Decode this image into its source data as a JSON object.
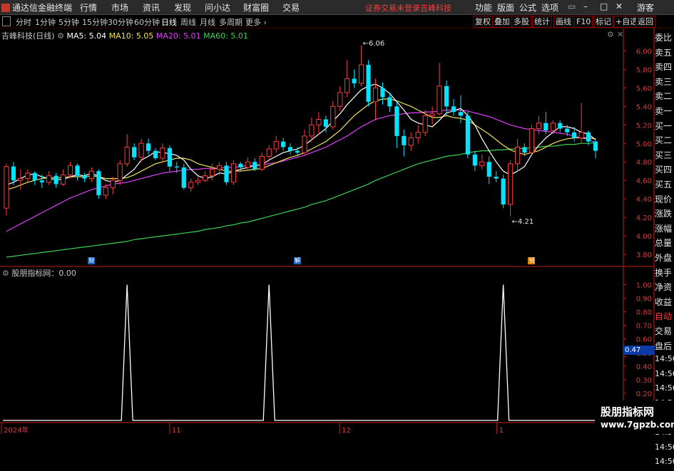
{
  "app": {
    "title": "通达信金融终端"
  },
  "menu": [
    "行情",
    "市场",
    "资讯",
    "发现",
    "问小达",
    "财富圈",
    "交易"
  ],
  "notice": "证券交易未登录",
  "stock_name_header": "吉峰科技",
  "window_menu": [
    "功能",
    "版面",
    "公式",
    "选项"
  ],
  "guest_label": "游客",
  "periods": [
    "分时",
    "1分钟",
    "5分钟",
    "15分钟",
    "30分钟",
    "60分钟",
    "日线",
    "周线",
    "月线",
    "多周期",
    "更多"
  ],
  "active_period": "日线",
  "right_buttons": [
    "复权",
    "叠加",
    "多股",
    "统计",
    "画线",
    "F10",
    "标记",
    "+自选",
    "返回"
  ],
  "chart_header": {
    "name": "吉峰科技(日线)",
    "ma5": "MA5: 5.04",
    "ma10": "MA10: 5.05",
    "ma20": "MA20: 5.01",
    "ma60": "MA60: 5.01"
  },
  "side_panel": [
    "委比",
    "卖五",
    "卖四",
    "卖三",
    "卖二",
    "卖一",
    "买一",
    "买二",
    "买三",
    "买四",
    "买五",
    "现价",
    "涨跌",
    "涨幅",
    "总量",
    "外盘",
    "换手",
    "净资",
    "收益",
    "自动",
    "交易",
    "盘后",
    "14:56",
    "14:56",
    "14:56",
    "14:56",
    "14:56",
    "14:56",
    "14:56",
    "14:56"
  ],
  "event_markers": [
    "财",
    "解",
    "预"
  ],
  "indicator_header": "股朋指标网：0.00",
  "indicator_value_box": "0.47",
  "watermark": {
    "name": "股朋指标网",
    "url": "www.7gpzb.com"
  },
  "x_axis_labels": [
    "2024年",
    "11",
    "12",
    "1"
  ],
  "colors": {
    "up": "#ff3b3b",
    "down": "#00e5ff",
    "ma5": "#ffffff",
    "ma10": "#f5e05a",
    "ma20": "#e040fb",
    "ma60": "#39d353",
    "axis": "#c81e1e"
  },
  "chart_data": [
    {
      "type": "candlestick",
      "title": "吉峰科技(日线)",
      "ylim": [
        3.7,
        6.15
      ],
      "y_ticks": [
        3.8,
        4.0,
        4.2,
        4.4,
        4.6,
        4.8,
        5.0,
        5.2,
        5.4,
        5.6,
        5.8,
        6.0
      ],
      "annotations": [
        {
          "label": "6.06",
          "value": 6.06
        },
        {
          "label": "4.21",
          "value": 4.21
        }
      ],
      "candles": [
        [
          4.3,
          4.75,
          4.78,
          4.22
        ],
        [
          4.75,
          4.6,
          4.8,
          4.55
        ],
        [
          4.6,
          4.62,
          4.72,
          4.5
        ],
        [
          4.62,
          4.68,
          4.72,
          4.58
        ],
        [
          4.68,
          4.6,
          4.7,
          4.55
        ],
        [
          4.6,
          4.58,
          4.66,
          4.52
        ],
        [
          4.58,
          4.65,
          4.7,
          4.55
        ],
        [
          4.65,
          4.56,
          4.68,
          4.52
        ],
        [
          4.56,
          4.66,
          4.72,
          4.54
        ],
        [
          4.66,
          4.76,
          4.8,
          4.62
        ],
        [
          4.76,
          4.65,
          4.78,
          4.6
        ],
        [
          4.65,
          4.62,
          4.68,
          4.58
        ],
        [
          4.62,
          4.7,
          4.74,
          4.58
        ],
        [
          4.7,
          4.44,
          4.72,
          4.4
        ],
        [
          4.44,
          4.52,
          4.56,
          4.4
        ],
        [
          4.52,
          4.6,
          4.64,
          4.45
        ],
        [
          4.6,
          4.78,
          4.82,
          4.55
        ],
        [
          4.78,
          4.96,
          5.1,
          4.75
        ],
        [
          4.96,
          4.85,
          5.0,
          4.82
        ],
        [
          4.85,
          5.0,
          5.05,
          4.8
        ],
        [
          5.0,
          4.92,
          5.05,
          4.88
        ],
        [
          4.92,
          4.84,
          4.95,
          4.82
        ],
        [
          4.84,
          4.95,
          5.0,
          4.8
        ],
        [
          4.95,
          4.75,
          4.98,
          4.7
        ],
        [
          4.75,
          4.74,
          4.8,
          4.68
        ],
        [
          4.74,
          4.52,
          4.78,
          4.5
        ],
        [
          4.52,
          4.58,
          4.62,
          4.48
        ],
        [
          4.58,
          4.6,
          4.65,
          4.55
        ],
        [
          4.6,
          4.65,
          4.7,
          4.58
        ],
        [
          4.65,
          4.72,
          4.78,
          4.6
        ],
        [
          4.72,
          4.76,
          4.8,
          4.66
        ],
        [
          4.76,
          4.58,
          4.8,
          4.55
        ],
        [
          4.58,
          4.78,
          4.82,
          4.55
        ],
        [
          4.78,
          4.74,
          4.8,
          4.7
        ],
        [
          4.74,
          4.8,
          4.85,
          4.72
        ],
        [
          4.8,
          4.72,
          4.84,
          4.7
        ],
        [
          4.72,
          4.86,
          4.9,
          4.7
        ],
        [
          4.86,
          4.94,
          4.98,
          4.8
        ],
        [
          4.94,
          5.02,
          5.08,
          4.9
        ],
        [
          5.02,
          4.96,
          5.06,
          4.92
        ],
        [
          4.96,
          4.92,
          5.0,
          4.88
        ],
        [
          4.92,
          4.9,
          4.96,
          4.86
        ],
        [
          4.9,
          5.08,
          5.15,
          4.88
        ],
        [
          5.08,
          5.2,
          5.28,
          5.02
        ],
        [
          5.2,
          5.26,
          5.34,
          5.1
        ],
        [
          5.26,
          5.18,
          5.3,
          5.12
        ],
        [
          5.18,
          5.4,
          5.46,
          5.15
        ],
        [
          5.4,
          5.55,
          5.62,
          5.35
        ],
        [
          5.55,
          5.7,
          5.9,
          5.5
        ],
        [
          5.7,
          5.65,
          5.8,
          5.6
        ],
        [
          5.65,
          5.85,
          6.06,
          5.62
        ],
        [
          5.85,
          5.45,
          5.9,
          5.4
        ],
        [
          5.45,
          5.6,
          5.7,
          5.25
        ],
        [
          5.6,
          5.5,
          5.66,
          5.42
        ],
        [
          5.5,
          5.4,
          5.55,
          5.34
        ],
        [
          5.4,
          5.08,
          5.45,
          4.95
        ],
        [
          5.08,
          4.98,
          5.15,
          4.86
        ],
        [
          4.98,
          5.06,
          5.12,
          4.92
        ],
        [
          5.06,
          5.12,
          5.2,
          5.0
        ],
        [
          5.12,
          5.3,
          5.36,
          5.08
        ],
        [
          5.3,
          5.32,
          5.4,
          5.2
        ],
        [
          5.32,
          5.62,
          5.87,
          5.3
        ],
        [
          5.62,
          5.4,
          5.68,
          5.3
        ],
        [
          5.4,
          5.34,
          5.48,
          5.3
        ],
        [
          5.34,
          5.3,
          5.52,
          5.22
        ],
        [
          5.3,
          4.88,
          5.34,
          4.84
        ],
        [
          4.88,
          4.76,
          4.92,
          4.7
        ],
        [
          4.76,
          4.8,
          4.88,
          4.72
        ],
        [
          4.8,
          4.64,
          4.86,
          4.56
        ],
        [
          4.64,
          4.62,
          4.7,
          4.58
        ],
        [
          4.62,
          4.34,
          4.66,
          4.3
        ],
        [
          4.34,
          4.78,
          4.82,
          4.21
        ],
        [
          4.78,
          4.96,
          5.05,
          4.7
        ],
        [
          4.96,
          4.9,
          5.0,
          4.86
        ],
        [
          4.9,
          5.16,
          5.2,
          4.88
        ],
        [
          5.16,
          5.22,
          5.3,
          5.1
        ],
        [
          5.22,
          5.14,
          5.34,
          5.1
        ],
        [
          5.14,
          5.22,
          5.25,
          5.1
        ],
        [
          5.22,
          5.16,
          5.25,
          5.12
        ],
        [
          5.16,
          5.12,
          5.2,
          5.08
        ],
        [
          5.12,
          5.06,
          5.18,
          5.02
        ],
        [
          5.06,
          5.12,
          5.44,
          5.0
        ],
        [
          5.12,
          5.02,
          5.14,
          4.98
        ],
        [
          5.02,
          4.92,
          5.04,
          4.84
        ]
      ],
      "series": [
        {
          "name": "MA5",
          "values": [
            4.55,
            4.58,
            4.62,
            4.66,
            4.67,
            4.64,
            4.62,
            4.61,
            4.61,
            4.64,
            4.66,
            4.65,
            4.68,
            4.64,
            4.6,
            4.58,
            4.6,
            4.66,
            4.72,
            4.82,
            4.86,
            4.91,
            4.9,
            4.89,
            4.87,
            4.82,
            4.72,
            4.65,
            4.62,
            4.64,
            4.68,
            4.67,
            4.7,
            4.72,
            4.74,
            4.76,
            4.77,
            4.82,
            4.86,
            4.9,
            4.92,
            4.94,
            4.98,
            5.04,
            5.1,
            5.16,
            5.24,
            5.32,
            5.42,
            5.5,
            5.58,
            5.62,
            5.64,
            5.6,
            5.54,
            5.45,
            5.36,
            5.26,
            5.22,
            5.2,
            5.18,
            5.25,
            5.33,
            5.35,
            5.38,
            5.3,
            5.2,
            5.05,
            4.92,
            4.8,
            4.7,
            4.66,
            4.7,
            4.75,
            4.88,
            4.98,
            5.06,
            5.12,
            5.18,
            5.18,
            5.16,
            5.12,
            5.1,
            5.04
          ]
        },
        {
          "name": "MA10",
          "values": [
            4.5,
            4.52,
            4.55,
            4.58,
            4.6,
            4.62,
            4.63,
            4.63,
            4.63,
            4.64,
            4.64,
            4.64,
            4.65,
            4.64,
            4.62,
            4.62,
            4.62,
            4.63,
            4.66,
            4.7,
            4.74,
            4.78,
            4.8,
            4.82,
            4.84,
            4.84,
            4.82,
            4.78,
            4.76,
            4.74,
            4.72,
            4.7,
            4.7,
            4.7,
            4.71,
            4.72,
            4.73,
            4.76,
            4.79,
            4.82,
            4.85,
            4.87,
            4.9,
            4.94,
            4.98,
            5.02,
            5.08,
            5.14,
            5.22,
            5.3,
            5.36,
            5.42,
            5.46,
            5.48,
            5.48,
            5.46,
            5.43,
            5.4,
            5.36,
            5.32,
            5.28,
            5.28,
            5.3,
            5.28,
            5.27,
            5.25,
            5.2,
            5.15,
            5.1,
            5.04,
            4.98,
            4.93,
            4.9,
            4.88,
            4.9,
            4.92,
            4.96,
            5.0,
            5.03,
            5.05,
            5.06,
            5.06,
            5.06,
            5.05
          ]
        },
        {
          "name": "MA20",
          "values": [
            4.05,
            4.09,
            4.13,
            4.17,
            4.21,
            4.25,
            4.29,
            4.33,
            4.37,
            4.41,
            4.44,
            4.47,
            4.5,
            4.52,
            4.54,
            4.56,
            4.57,
            4.58,
            4.6,
            4.62,
            4.64,
            4.66,
            4.68,
            4.69,
            4.7,
            4.71,
            4.72,
            4.72,
            4.73,
            4.73,
            4.73,
            4.74,
            4.74,
            4.75,
            4.76,
            4.76,
            4.77,
            4.78,
            4.79,
            4.81,
            4.83,
            4.85,
            4.87,
            4.9,
            4.93,
            4.96,
            5.0,
            5.04,
            5.08,
            5.13,
            5.18,
            5.22,
            5.26,
            5.28,
            5.3,
            5.31,
            5.32,
            5.33,
            5.33,
            5.34,
            5.34,
            5.35,
            5.36,
            5.36,
            5.36,
            5.35,
            5.33,
            5.31,
            5.29,
            5.26,
            5.23,
            5.2,
            5.18,
            5.16,
            5.15,
            5.14,
            5.13,
            5.12,
            5.11,
            5.1,
            5.08,
            5.06,
            5.04,
            5.01
          ]
        },
        {
          "name": "MA60",
          "values": [
            3.77,
            3.78,
            3.79,
            3.8,
            3.81,
            3.82,
            3.83,
            3.84,
            3.85,
            3.86,
            3.87,
            3.88,
            3.89,
            3.9,
            3.91,
            3.92,
            3.93,
            3.94,
            3.96,
            3.97,
            3.98,
            3.99,
            4.0,
            4.01,
            4.02,
            4.03,
            4.04,
            4.05,
            4.07,
            4.08,
            4.09,
            4.11,
            4.12,
            4.14,
            4.15,
            4.17,
            4.19,
            4.21,
            4.23,
            4.25,
            4.27,
            4.29,
            4.31,
            4.34,
            4.36,
            4.38,
            4.41,
            4.44,
            4.47,
            4.5,
            4.53,
            4.56,
            4.6,
            4.63,
            4.66,
            4.69,
            4.72,
            4.75,
            4.78,
            4.8,
            4.82,
            4.84,
            4.86,
            4.87,
            4.88,
            4.9,
            4.91,
            4.92,
            4.92,
            4.93,
            4.93,
            4.94,
            4.94,
            4.95,
            4.95,
            4.96,
            4.97,
            4.97,
            4.98,
            4.99,
            4.99,
            5.0,
            5.0,
            5.01
          ]
        }
      ]
    },
    {
      "type": "line",
      "title": "股朋指标网",
      "ylim": [
        0,
        1.05
      ],
      "y_ticks": [
        0.1,
        0.2,
        0.3,
        0.4,
        0.47,
        0.5,
        0.6,
        0.7,
        0.8,
        0.9,
        1.0
      ],
      "spikes_at_candle_index": [
        17,
        37,
        70
      ],
      "values_note_free": [
        0,
        1,
        0
      ]
    }
  ]
}
